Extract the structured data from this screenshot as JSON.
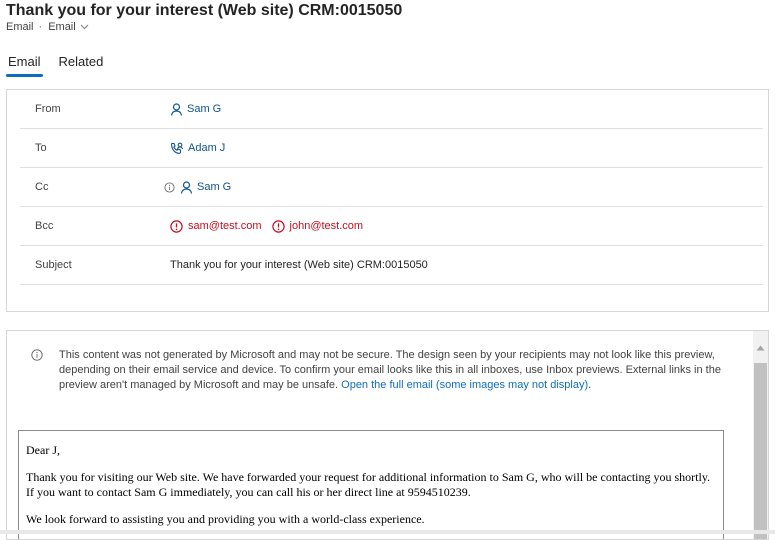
{
  "header": {
    "title": "Thank you for your interest (Web site) CRM:0015050",
    "entity": "Email",
    "view": "Email"
  },
  "tabs": [
    {
      "label": "Email",
      "active": true
    },
    {
      "label": "Related",
      "active": false
    }
  ],
  "fields": {
    "from": {
      "label": "From",
      "value": "Sam G"
    },
    "to": {
      "label": "To",
      "value": "Adam J"
    },
    "cc": {
      "label": "Cc",
      "value": "Sam G"
    },
    "bcc": {
      "label": "Bcc",
      "values": [
        "sam@test.com",
        "john@test.com"
      ]
    },
    "subject": {
      "label": "Subject",
      "value": "Thank you for your interest (Web site) CRM:0015050"
    }
  },
  "notice": {
    "text": "This content was not generated by Microsoft and may not be secure. The design seen by your recipients may not look like this preview, depending on their email service and device. To confirm your email looks like this in all inboxes, use Inbox previews. External links in the preview aren't managed by Microsoft and may be unsafe. ",
    "link": "Open the full email (some images may not display)",
    "tail": "."
  },
  "email_body": {
    "greeting": "Dear J,",
    "paragraph1": "Thank you for visiting our Web site. We have forwarded your request for additional information to Sam G, who will be contacting you shortly. If you want to contact Sam G immediately, you can call his or her direct line at 9594510239.",
    "paragraph2": "We look forward to assisting you and providing you with a world-class experience."
  },
  "colors": {
    "accent": "#0f6cbd",
    "link": "#0f548c",
    "error": "#c50f1f"
  }
}
